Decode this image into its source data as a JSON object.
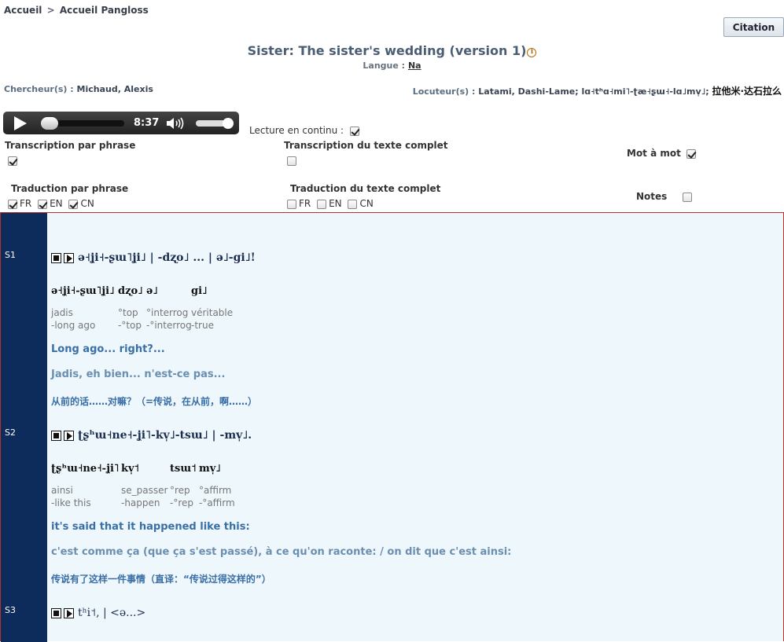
{
  "breadcrumb": {
    "home": "Accueil",
    "separator": ">",
    "current": "Accueil Pangloss"
  },
  "citation_button": "Citation",
  "title": "Sister: The sister's wedding (version 1)",
  "language": {
    "label": "Langue :",
    "value": "Na"
  },
  "researcher": {
    "label": "Chercheur(s) :",
    "value": "Michaud, Alexis"
  },
  "speaker": {
    "label": "Locuteur(s) :",
    "value": "Latami, Dashi-Lame; lɑ˧tʰɑ˧mi˥-ʈæ˧ʂɯ˧-lɑ˩mv̩˩;",
    "value_cn": "拉他米·达石拉么"
  },
  "player": {
    "time": "8:37",
    "volume": 1.0,
    "progress": 0.0
  },
  "continuous": {
    "label": "Lecture en continu :",
    "checked": true
  },
  "options": {
    "transcription_sentence": {
      "label": "Transcription par phrase",
      "checked": true
    },
    "transcription_full": {
      "label": "Transcription du texte complet",
      "checked": false
    },
    "word_by_word": {
      "label": "Mot à mot",
      "checked": true
    },
    "translation_sentence": {
      "label": "Traduction par phrase",
      "langs": [
        {
          "code": "FR",
          "checked": true
        },
        {
          "code": "EN",
          "checked": true
        },
        {
          "code": "CN",
          "checked": true
        }
      ]
    },
    "translation_full": {
      "label": "Traduction du texte complet",
      "langs": [
        {
          "code": "FR",
          "checked": false
        },
        {
          "code": "EN",
          "checked": false
        },
        {
          "code": "CN",
          "checked": false
        }
      ]
    },
    "notes": {
      "label": "Notes",
      "checked": false
    }
  },
  "sentences": [
    {
      "id": "S1",
      "transcription": "ə˧ʝi˧-ʂɯ˥ʝi˩ | -dʐo˩ ... | ə˩-gi˩!",
      "words": [
        {
          "form": "ə˧ʝi˧-ʂɯ˥ʝi˩",
          "gloss_fr": "jadis",
          "gloss_en": "-long ago"
        },
        {
          "form": "dʐo˩",
          "gloss_fr": "°top",
          "gloss_en": "-°top"
        },
        {
          "form": "ə˩",
          "gloss_fr": "°interrog",
          "gloss_en": "-°interrog"
        },
        {
          "form": "gi˩",
          "gloss_fr": "véritable",
          "gloss_en": "-true"
        }
      ],
      "translation_en": "Long ago... right?...",
      "translation_fr": "Jadis, eh bien... n'est-ce pas...",
      "translation_cn": "从前的话……对嘛？（=传说，在从前，啊……）"
    },
    {
      "id": "S2",
      "transcription": "ʈʂʰɯ˧ne˧-ʝi˥-kv̩˩-tsɯ˩ | -mv̩˩.",
      "words": [
        {
          "form": "ʈʂʰɯ˧ne˧-ʝi˥",
          "gloss_fr": "ainsi",
          "gloss_en": "-like this"
        },
        {
          "form": "kv̩˦",
          "gloss_fr": "se_passer",
          "gloss_en": "-happen"
        },
        {
          "form": "tsɯ˦",
          "gloss_fr": "°rep",
          "gloss_en": "-°rep"
        },
        {
          "form": "mv̩˩",
          "gloss_fr": "°affirm",
          "gloss_en": "-°affirm"
        }
      ],
      "translation_en": "it's said that it happened like this:",
      "translation_fr": "c'est comme ça (que ça s'est passé), à ce qu'on raconte: / on dit que c'est ainsi:",
      "translation_cn": "传说有了这样一件事情（直译：“传说过得这样的”）"
    },
    {
      "id": "S3",
      "transcription": "tʰi˦, | <ə...>"
    }
  ]
}
